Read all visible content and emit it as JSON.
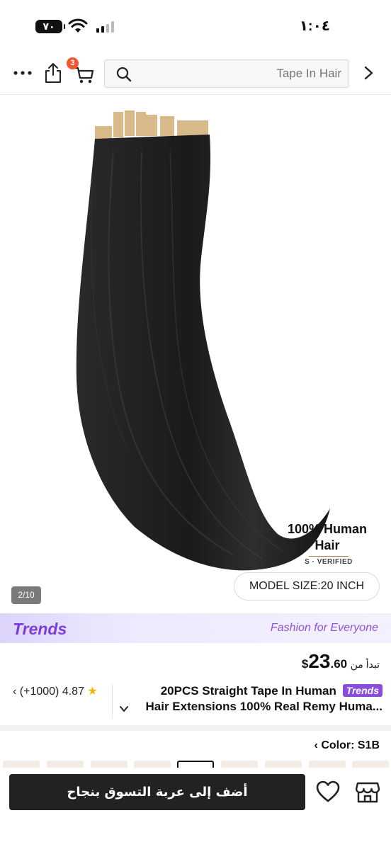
{
  "status_bar": {
    "time": "١:٠٤",
    "battery": "٧٠"
  },
  "nav": {
    "cart_count": "3",
    "search_placeholder": "Tape In Hair"
  },
  "gallery": {
    "badge_line1": "100% Human",
    "badge_line2": "Hair",
    "verified": "S · VERIFIED",
    "model_size": "MODEL SIZE:20 INCH",
    "counter": "2/10"
  },
  "trends": {
    "logo": "Trends",
    "tagline": "Fashion for Everyone"
  },
  "price": {
    "prefix": "تبدأ من",
    "currency": "$",
    "integer": "23",
    "decimal": ".60"
  },
  "product": {
    "title_line1": "20PCS Straight Tape In Human",
    "title_line2": "Hair Extensions 100% Real Remy Huma...",
    "trends_badge": "Trends",
    "rating": "4.87",
    "reviews": "(+1000)"
  },
  "color": {
    "label": "Color: S1B"
  },
  "actions": {
    "add_to_cart": "أضف إلى عربة التسوق بنجاح"
  },
  "colors": {
    "accent": "#7b3dd8",
    "badge": "#f2572e",
    "star": "#f4b400",
    "button": "#222222"
  }
}
